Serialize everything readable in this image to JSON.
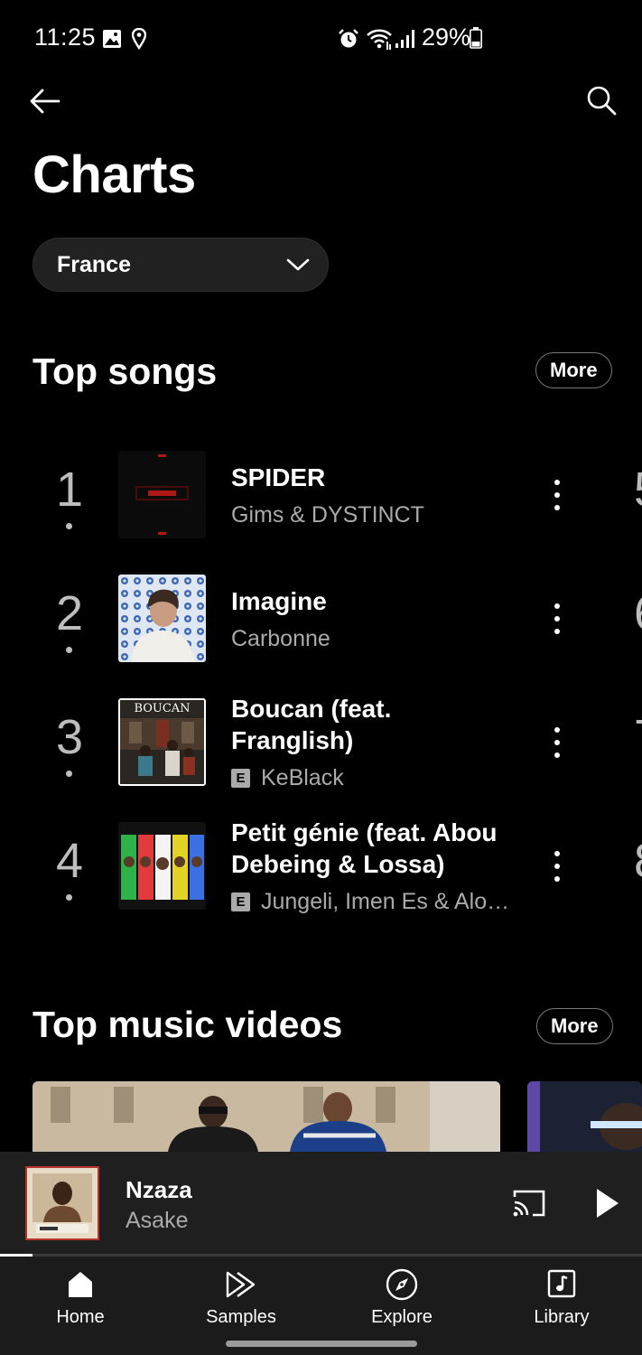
{
  "status": {
    "time": "11:25",
    "battery": "29%",
    "icons": [
      "gallery-icon",
      "location-icon",
      "alarm-icon",
      "wifi-icon",
      "signal-icon",
      "battery-icon"
    ]
  },
  "header": {
    "back_icon": "arrow-left-icon",
    "search_icon": "search-icon",
    "title": "Charts"
  },
  "country": {
    "selected": "France"
  },
  "top_songs": {
    "title": "Top songs",
    "more_label": "More",
    "items": [
      {
        "rank": "1",
        "title": "SPIDER",
        "artist": "Gims & DYSTINCT",
        "explicit": false
      },
      {
        "rank": "2",
        "title": "Imagine",
        "artist": "Carbonne",
        "explicit": false
      },
      {
        "rank": "3",
        "title": "Boucan (feat. Franglish)",
        "artist": "KeBlack",
        "explicit": true
      },
      {
        "rank": "4",
        "title": "Petit génie (feat. Abou Debeing & Lossa)",
        "artist": "Jungeli, Imen Es & Alo…",
        "explicit": true
      }
    ],
    "explicit_badge": "E"
  },
  "top_videos": {
    "title": "Top music videos",
    "more_label": "More"
  },
  "mini_player": {
    "title": "Nzaza",
    "artist": "Asake",
    "progress": 0.05,
    "accent": "#b4352c"
  },
  "nav": {
    "items": [
      {
        "label": "Home",
        "icon": "home-icon",
        "active": true
      },
      {
        "label": "Samples",
        "icon": "samples-icon",
        "active": false
      },
      {
        "label": "Explore",
        "icon": "compass-icon",
        "active": false
      },
      {
        "label": "Library",
        "icon": "library-icon",
        "active": false
      }
    ]
  },
  "colors": {
    "background": "#000000",
    "surface": "#1f1f1f",
    "muted_text": "#aaaaaa"
  }
}
